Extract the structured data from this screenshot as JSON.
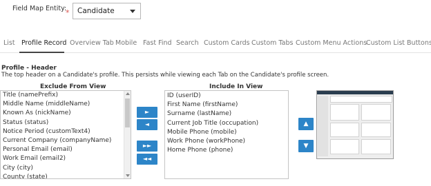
{
  "field_map": {
    "label": "Field Map Entity:",
    "required_marker": "*",
    "selected": "Candidate"
  },
  "tabs": [
    {
      "label": "List"
    },
    {
      "label": "Profile Record",
      "active": true
    },
    {
      "label": "Overview Tab"
    },
    {
      "label": "Mobile"
    },
    {
      "label": "Fast Find"
    },
    {
      "label": "Search"
    },
    {
      "label": "Custom Cards"
    },
    {
      "label": "Custom Tabs"
    },
    {
      "label": "Custom Menu Actions"
    },
    {
      "label": "Custom List Buttons"
    }
  ],
  "section": {
    "title": "Profile - Header",
    "description": "The top header on a Candidate's profile. This persists while viewing each Tab on the Candidate's profile screen."
  },
  "exclude": {
    "heading": "Exclude From View",
    "items": [
      "Title (namePrefix)",
      "Middle Name (middleName)",
      "Known As (nickName)",
      "Status (status)",
      "Notice Period (customText4)",
      "Current Company (companyName)",
      "Personal Email (email)",
      "Work Email (email2)",
      "City (city)",
      "County (state)"
    ]
  },
  "include": {
    "heading": "Include In View",
    "items": [
      "ID (userID)",
      "First Name (firstName)",
      "Surname (lastName)",
      "Current Job Title (occupation)",
      "Mobile Phone (mobile)",
      "Work Phone (workPhone)",
      "Home Phone (phone)"
    ]
  },
  "buttons": {
    "move_right": "►",
    "move_left": "◄",
    "move_all_right": "►►",
    "move_all_left": "◄◄",
    "move_up": "▲",
    "move_down": "▼"
  },
  "colors": {
    "button_blue": "#2d85c8",
    "required_red": "#d9534f",
    "preview_header": "#2a3d4f"
  }
}
